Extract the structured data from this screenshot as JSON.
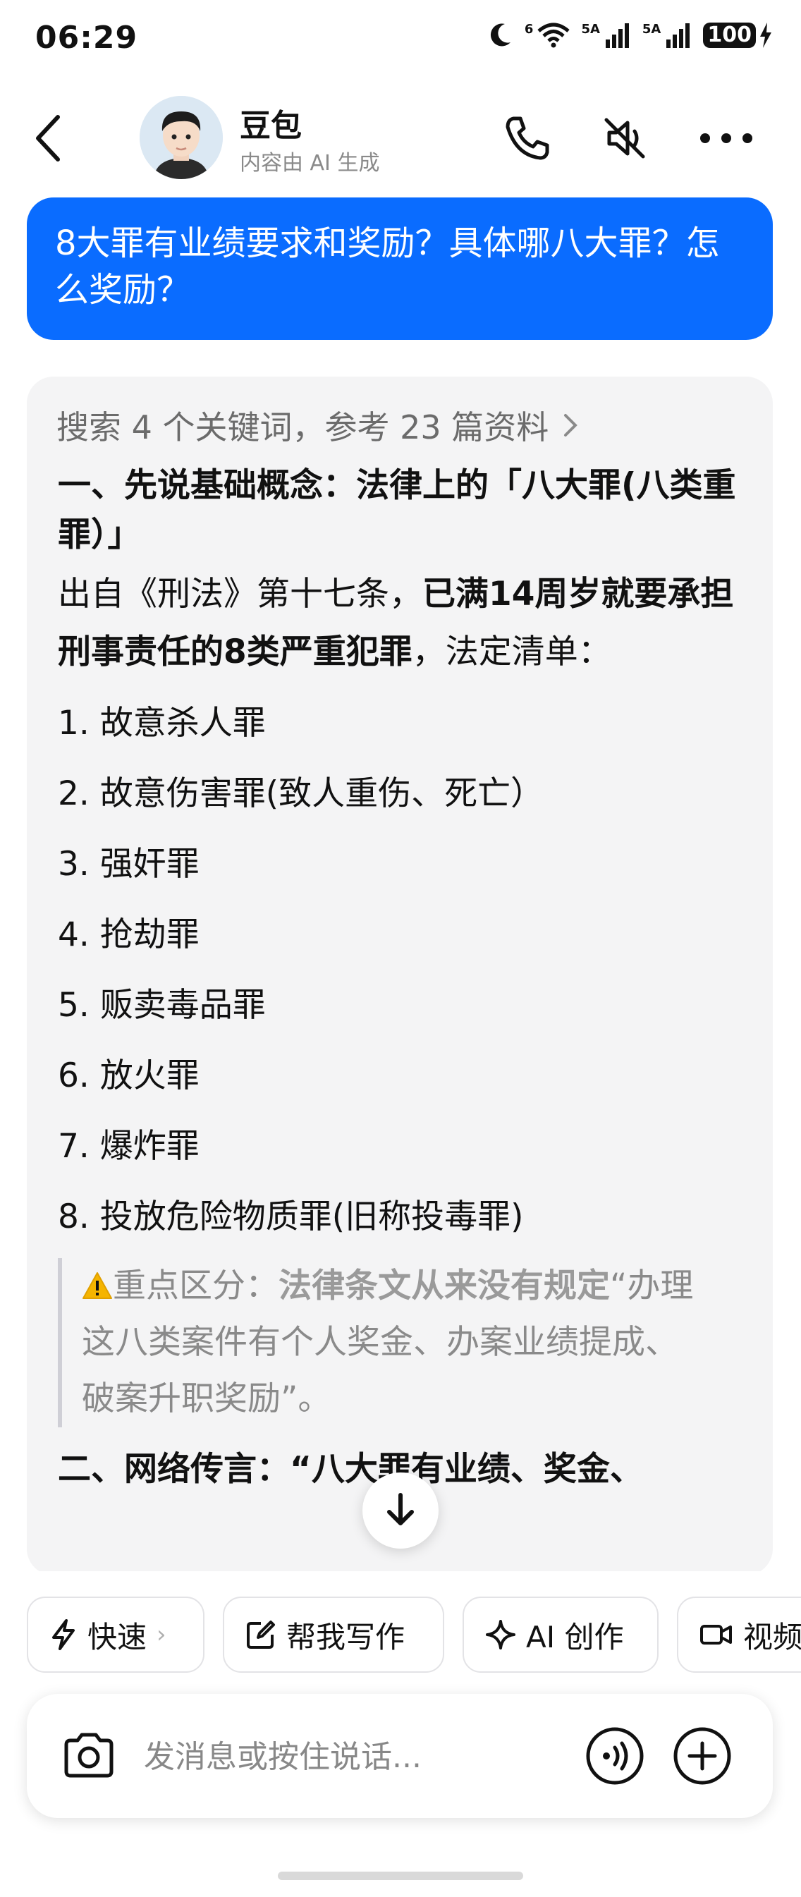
{
  "status_bar": {
    "time": "06:29",
    "network_1": "6",
    "network_2": "5A",
    "network_3": "5A",
    "battery": "100"
  },
  "header": {
    "bot_name": "豆包",
    "bot_subtitle": "内容由 AI 生成",
    "icons": [
      "back-icon",
      "phone-icon",
      "mute-icon",
      "more-icon"
    ]
  },
  "user_message": "8大罪有业绩要求和奖励？具体哪八大罪？怎么奖励？",
  "reply": {
    "search_summary": "搜索 4 个关键词，参考 23 篇资料",
    "heading1": "一、先说基础概念：法律上的「八大罪(八类重罪）」",
    "para_pre": "出自《刑法》第十七条，",
    "para_bold": "已满14周岁就要承担刑事责任的8类严重犯罪",
    "para_post": "，法定清单：",
    "crimes": [
      "1. 故意杀人罪",
      "2. 故意伤害罪(致人重伤、死亡）",
      "3. 强奸罪",
      "4. 抢劫罪",
      "5. 贩卖毒品罪",
      "6. 放火罪",
      "7. 爆炸罪",
      "8. 投放危险物质罪(旧称投毒罪)"
    ],
    "note_label": "重点区分：",
    "note_bold": "法律条文从来没有规定",
    "note_text": "“办理这八类案件有个人奖金、办案业绩提成、破案升职奖励”。",
    "heading2": "二、网络传言：“八大罪有业绩、奖金、"
  },
  "chips": [
    {
      "label": "快速",
      "icon": "lightning-icon"
    },
    {
      "label": "帮我写作",
      "icon": "edit-icon"
    },
    {
      "label": "AI 创作",
      "icon": "sparkle-icon"
    },
    {
      "label": "视频",
      "icon": "video-icon"
    }
  ],
  "input": {
    "placeholder": "发消息或按住说话..."
  },
  "colors": {
    "accent": "#0a6cff",
    "card_bg": "#f4f4f5",
    "muted_text": "#8a8a8a"
  }
}
